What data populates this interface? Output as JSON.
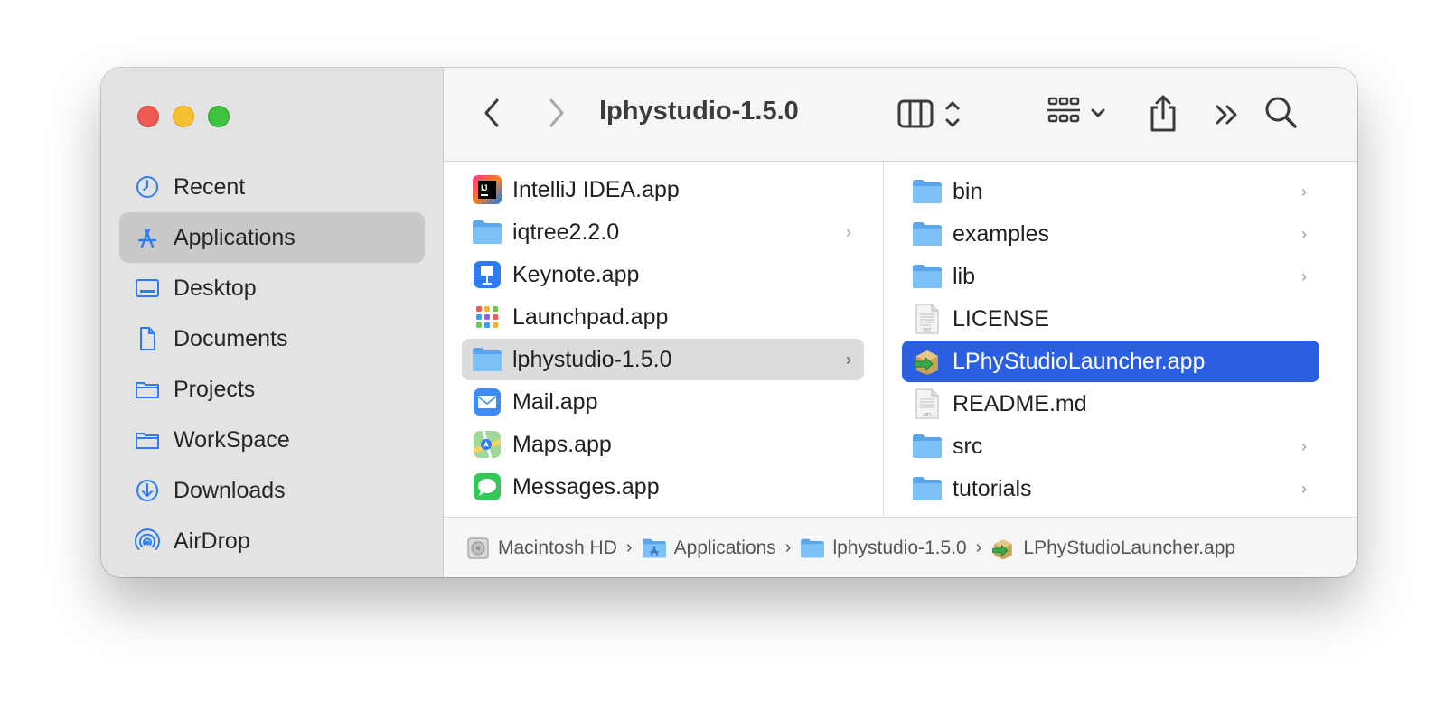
{
  "window": {
    "title": "lphystudio-1.5.0"
  },
  "sidebar": {
    "items": [
      {
        "label": "Recent",
        "icon": "clock-icon",
        "selected": false
      },
      {
        "label": "Applications",
        "icon": "applications-icon",
        "selected": true
      },
      {
        "label": "Desktop",
        "icon": "desktop-icon",
        "selected": false
      },
      {
        "label": "Documents",
        "icon": "document-icon",
        "selected": false
      },
      {
        "label": "Projects",
        "icon": "folder-icon",
        "selected": false
      },
      {
        "label": "WorkSpace",
        "icon": "folder-icon",
        "selected": false
      },
      {
        "label": "Downloads",
        "icon": "download-icon",
        "selected": false
      },
      {
        "label": "AirDrop",
        "icon": "airdrop-icon",
        "selected": false
      }
    ]
  },
  "column1": {
    "items": [
      {
        "label": "IntelliJ IDEA.app",
        "icon": "intellij-icon",
        "has_children": false
      },
      {
        "label": "iqtree2.2.0",
        "icon": "folder-icon",
        "has_children": true
      },
      {
        "label": "Keynote.app",
        "icon": "keynote-icon",
        "has_children": false
      },
      {
        "label": "Launchpad.app",
        "icon": "launchpad-icon",
        "has_children": false
      },
      {
        "label": "lphystudio-1.5.0",
        "icon": "folder-icon",
        "has_children": true,
        "selected": true
      },
      {
        "label": "Mail.app",
        "icon": "mail-icon",
        "has_children": false
      },
      {
        "label": "Maps.app",
        "icon": "maps-icon",
        "has_children": false
      },
      {
        "label": "Messages.app",
        "icon": "messages-icon",
        "has_children": false
      }
    ]
  },
  "column2": {
    "items": [
      {
        "label": "bin",
        "icon": "folder-icon",
        "has_children": true
      },
      {
        "label": "examples",
        "icon": "folder-icon",
        "has_children": true
      },
      {
        "label": "lib",
        "icon": "folder-icon",
        "has_children": true
      },
      {
        "label": "LICENSE",
        "icon": "text-file-icon",
        "has_children": false
      },
      {
        "label": "LPhyStudioLauncher.app",
        "icon": "launcher-app-icon",
        "has_children": false,
        "selected": true
      },
      {
        "label": "README.md",
        "icon": "markdown-file-icon",
        "has_children": false
      },
      {
        "label": "src",
        "icon": "folder-icon",
        "has_children": true
      },
      {
        "label": "tutorials",
        "icon": "folder-icon",
        "has_children": true
      }
    ]
  },
  "pathbar": {
    "crumbs": [
      {
        "label": "Macintosh HD",
        "icon": "hard-drive-icon"
      },
      {
        "label": "Applications",
        "icon": "applications-folder-icon"
      },
      {
        "label": "lphystudio-1.5.0",
        "icon": "folder-icon"
      },
      {
        "label": "LPhyStudioLauncher.app",
        "icon": "launcher-app-icon"
      }
    ],
    "separator": "›"
  },
  "colors": {
    "selection_blue": "#2b5fe0",
    "folder_blue": "#6cb4f2",
    "sidebar_icon": "#2d7cf6"
  }
}
